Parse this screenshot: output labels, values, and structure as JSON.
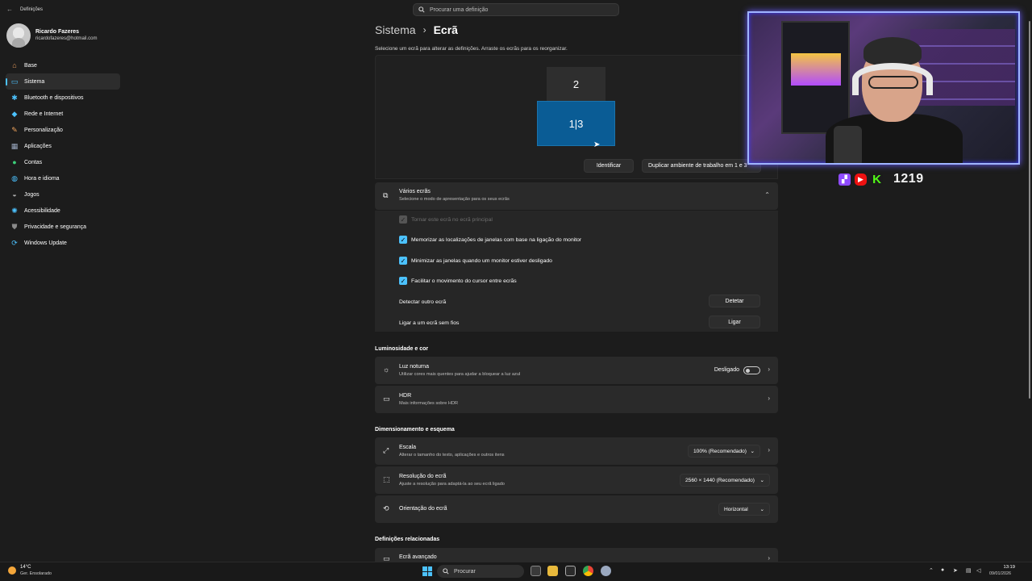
{
  "window": {
    "back_icon": "back-arrow-icon",
    "title": "Definições",
    "search_placeholder": "Procurar uma definição"
  },
  "user": {
    "name": "Ricardo Fazeres",
    "email": "ricardofazeres@hotmail.com"
  },
  "sidebar": {
    "items": [
      {
        "label": "Base",
        "icon": "home-icon",
        "color": "#e89c5c",
        "active": false
      },
      {
        "label": "Sistema",
        "icon": "system-icon",
        "color": "#4cc2ff",
        "active": true
      },
      {
        "label": "Bluetooth e dispositivos",
        "icon": "bluetooth-icon",
        "color": "#4cc2ff",
        "active": false
      },
      {
        "label": "Rede e Internet",
        "icon": "network-icon",
        "color": "#4cc2ff",
        "active": false
      },
      {
        "label": "Personalização",
        "icon": "brush-icon",
        "color": "#f0a45c",
        "active": false
      },
      {
        "label": "Aplicações",
        "icon": "apps-icon",
        "color": "#9aa8bf",
        "active": false
      },
      {
        "label": "Contas",
        "icon": "account-icon",
        "color": "#3ccf7a",
        "active": false
      },
      {
        "label": "Hora e idioma",
        "icon": "globe-clock-icon",
        "color": "#4cc2ff",
        "active": false
      },
      {
        "label": "Jogos",
        "icon": "gamepad-icon",
        "color": "#b0b0b0",
        "active": false
      },
      {
        "label": "Acessibilidade",
        "icon": "accessibility-icon",
        "color": "#4cc2ff",
        "active": false
      },
      {
        "label": "Privacidade e segurança",
        "icon": "shield-icon",
        "color": "#8a8a8a",
        "active": false
      },
      {
        "label": "Windows Update",
        "icon": "update-icon",
        "color": "#4cc2ff",
        "active": false
      }
    ]
  },
  "header": {
    "breadcrumb_parent": "Sistema",
    "breadcrumb_current": "Ecrã",
    "hint": "Selecione um ecrã para alterar as definições. Arraste os ecrãs para os reorganizar."
  },
  "arrangement": {
    "monitor_2": "2",
    "monitor_13": "1|3",
    "identify": "Identificar",
    "duplicate": "Duplicar ambiente de trabalho em 1 e 3"
  },
  "multi": {
    "title": "Vários ecrãs",
    "subtitle": "Selecione o modo de apresentação para os seus ecrãs",
    "opt_main": "Tornar este ecrã no ecrã principal",
    "opt_remember": "Memorizar as localizações de janelas com base na ligação do monitor",
    "opt_minimize": "Minimizar as janelas quando um monitor estiver desligado",
    "opt_cursor": "Facilitar o movimento do cursor entre ecrãs",
    "detect_label": "Detectar outro ecrã",
    "detect_btn": "Detetar",
    "wireless_label": "Ligar a um ecrã sem fios",
    "wireless_btn": "Ligar"
  },
  "brightness": {
    "section": "Luminosidade e cor",
    "night_title": "Luz noturna",
    "night_sub": "Utilizar cores mais quentes para ajudar a bloquear a luz azul",
    "night_state": "Desligado",
    "hdr_title": "HDR",
    "hdr_link": "Mais informações sobre HDR"
  },
  "scale": {
    "section": "Dimensionamento e esquema",
    "scale_title": "Escala",
    "scale_sub": "Alterar o tamanho do texto, aplicações e outros itens",
    "scale_value": "100% (Recomendado)",
    "res_title": "Resolução do ecrã",
    "res_sub": "Ajuste a resolução para adaptá-la ao seu ecrã ligado",
    "res_value": "2560 × 1440 (Recomendado)",
    "orient_title": "Orientação do ecrã",
    "orient_value": "Horizontal"
  },
  "related": {
    "section": "Definições relacionadas",
    "advanced": "Ecrã avançado"
  },
  "overlay": {
    "sub_count": "1219",
    "twitch_icon": "twitch-icon",
    "youtube_icon": "youtube-icon",
    "kick_icon": "kick-icon"
  },
  "taskbar": {
    "temp": "14°C",
    "weather": "Ger. Ensolarado",
    "search": "Procurar",
    "time": "13:19",
    "date": "09/01/2026"
  }
}
